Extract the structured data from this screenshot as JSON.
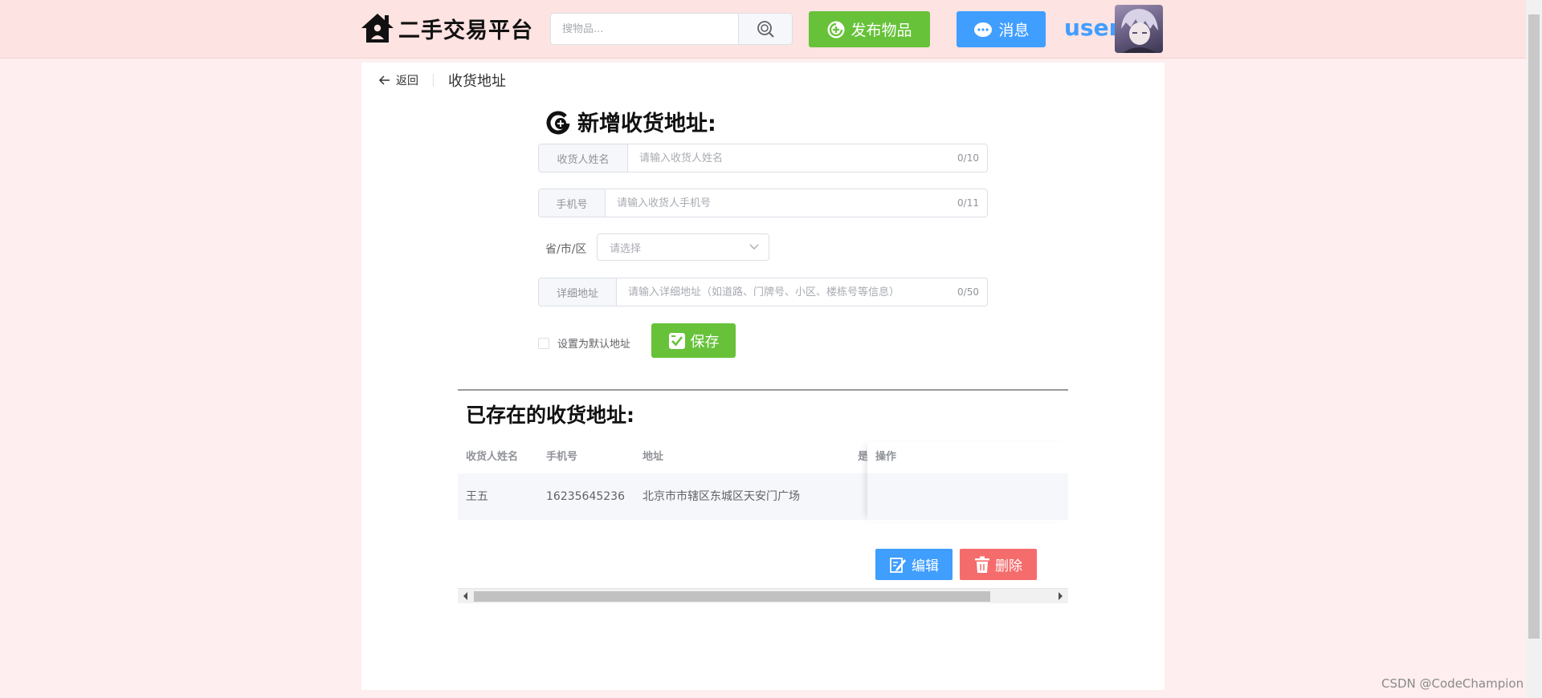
{
  "header": {
    "logo_text": "二手交易平台",
    "search_placeholder": "搜物品...",
    "publish_label": "发布物品",
    "message_label": "消息",
    "username": "user"
  },
  "page_header": {
    "back_label": "返回",
    "title": "收货地址"
  },
  "form": {
    "title": "新增收货地址:",
    "name_label": "收货人姓名",
    "name_placeholder": "请输入收货人姓名",
    "name_count": "0/10",
    "phone_label": "手机号",
    "phone_placeholder": "请输入收货人手机号",
    "phone_count": "0/11",
    "region_label": "省/市/区",
    "region_placeholder": "请选择",
    "detail_label": "详细地址",
    "detail_placeholder": "请输入详细地址（如道路、门牌号、小区、楼栋号等信息）",
    "detail_count": "0/50",
    "default_label": "设置为默认地址",
    "save_label": "保存"
  },
  "list": {
    "title": "已存在的收货地址:",
    "columns": [
      "收货人姓名",
      "手机号",
      "地址",
      "是",
      "操作"
    ],
    "rows": [
      {
        "name": "王五",
        "phone": "16235645236",
        "address": "北京市市辖区东城区天安门广场"
      }
    ],
    "edit_label": "编辑",
    "delete_label": "删除"
  },
  "watermark": "CSDN @CodeChampion",
  "colors": {
    "success": "#67c23a",
    "primary": "#409eff",
    "danger": "#f56c6c",
    "header_bg": "#fde3e1",
    "page_bg": "#feeeef"
  }
}
